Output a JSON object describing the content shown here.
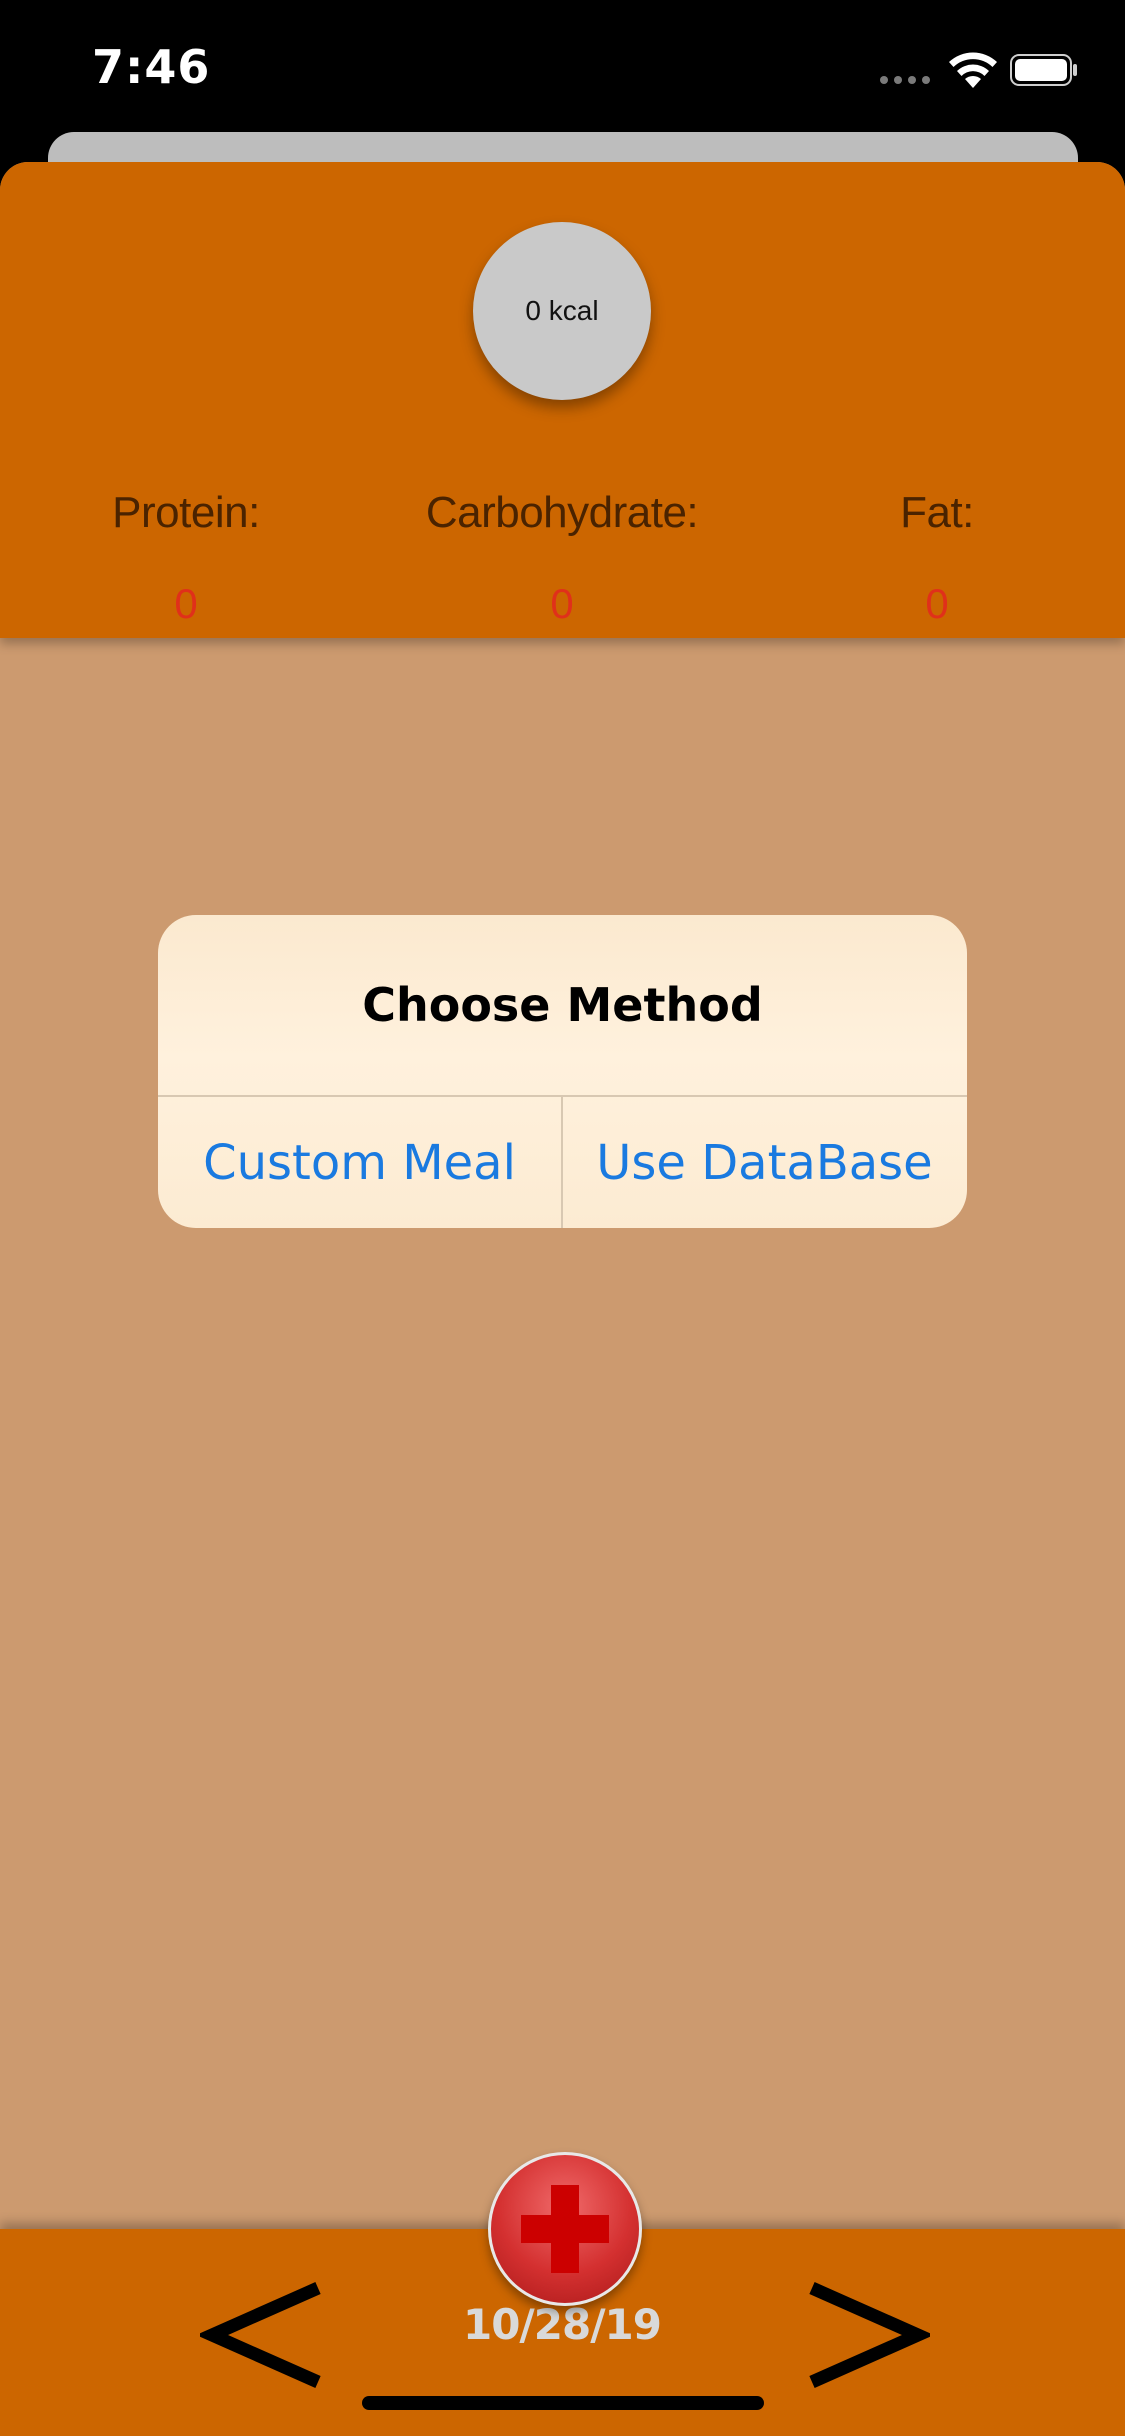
{
  "status_bar": {
    "time": "7:46"
  },
  "header": {
    "kcal_label": "0 kcal",
    "macros": [
      {
        "label": "Protein:",
        "value": "0"
      },
      {
        "label": "Carbohydrate:",
        "value": "0"
      },
      {
        "label": "Fat:",
        "value": "0"
      }
    ]
  },
  "alert": {
    "title": "Choose Method",
    "buttons": [
      {
        "label": "Custom Meal"
      },
      {
        "label": "Use DataBase"
      }
    ]
  },
  "footer": {
    "date": "10/28/19",
    "prev_icon": "chevron-left-icon",
    "next_icon": "chevron-right-icon",
    "add_icon": "plus-icon"
  },
  "colors": {
    "header_bg": "#cc6600",
    "body_bg": "#cc9a6f",
    "accent_blue": "#1a7ae0",
    "value_red": "#e0301a",
    "add_button_red": "#d43030"
  }
}
